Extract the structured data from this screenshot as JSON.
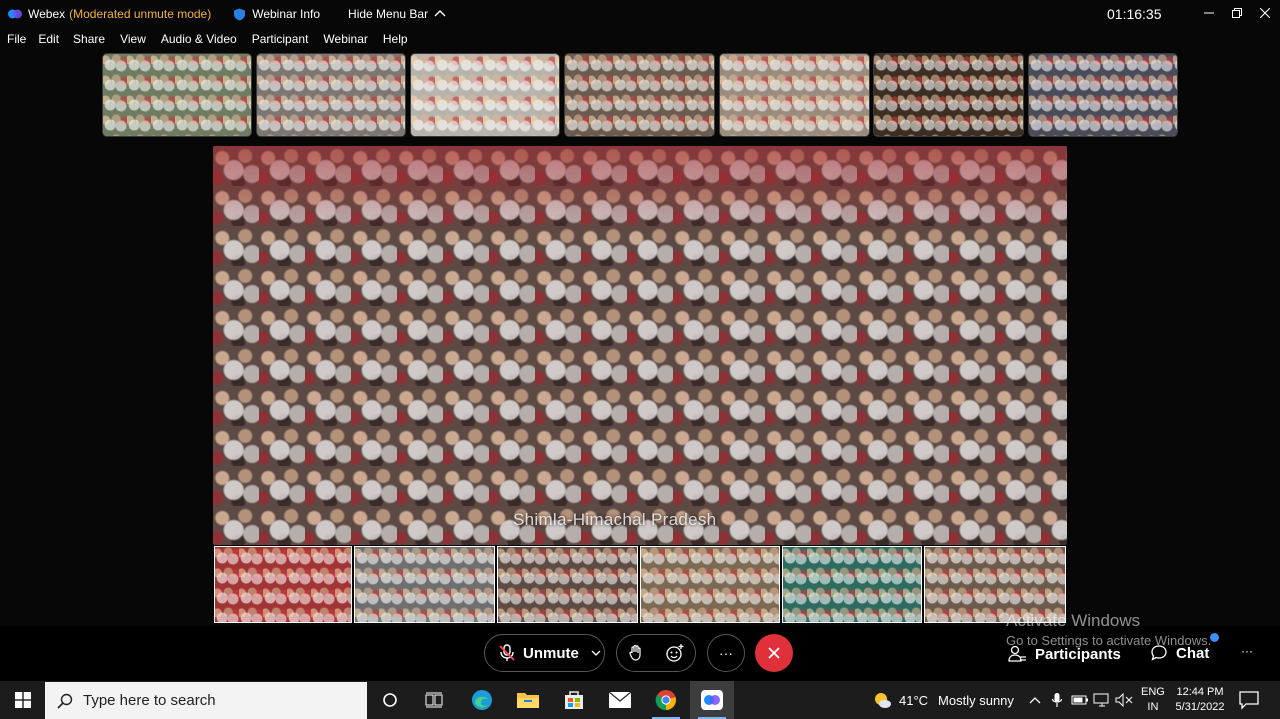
{
  "titlebar": {
    "app_name": "Webex",
    "mode": "(Moderated unmute mode)",
    "webinar_info": "Webinar Info",
    "hide_menu": "Hide Menu Bar",
    "timer": "01:16:35"
  },
  "menu": [
    "File",
    "Edit",
    "Share",
    "View",
    "Audio & Video",
    "Participant",
    "Webinar",
    "Help"
  ],
  "main_video": {
    "label": "Shimla-Himachal Pradesh"
  },
  "controls": {
    "unmute_label": "Unmute",
    "more_label": "···",
    "participants_label": "Participants",
    "chat_label": "Chat",
    "overflow_label": "···"
  },
  "watermark": {
    "line1": "Activate Windows",
    "line2": "Go to Settings to activate Windows."
  },
  "taskbar": {
    "search_placeholder": "Type here to search",
    "weather_temp": "41°C",
    "weather_desc": "Mostly sunny",
    "lang_top": "ENG",
    "lang_bottom": "IN",
    "time": "12:44 PM",
    "date": "5/31/2022"
  },
  "colors": {
    "mode_text": "#f3b23a",
    "leave_button": "#e0313b",
    "notification_dot": "#3b8ff0"
  }
}
